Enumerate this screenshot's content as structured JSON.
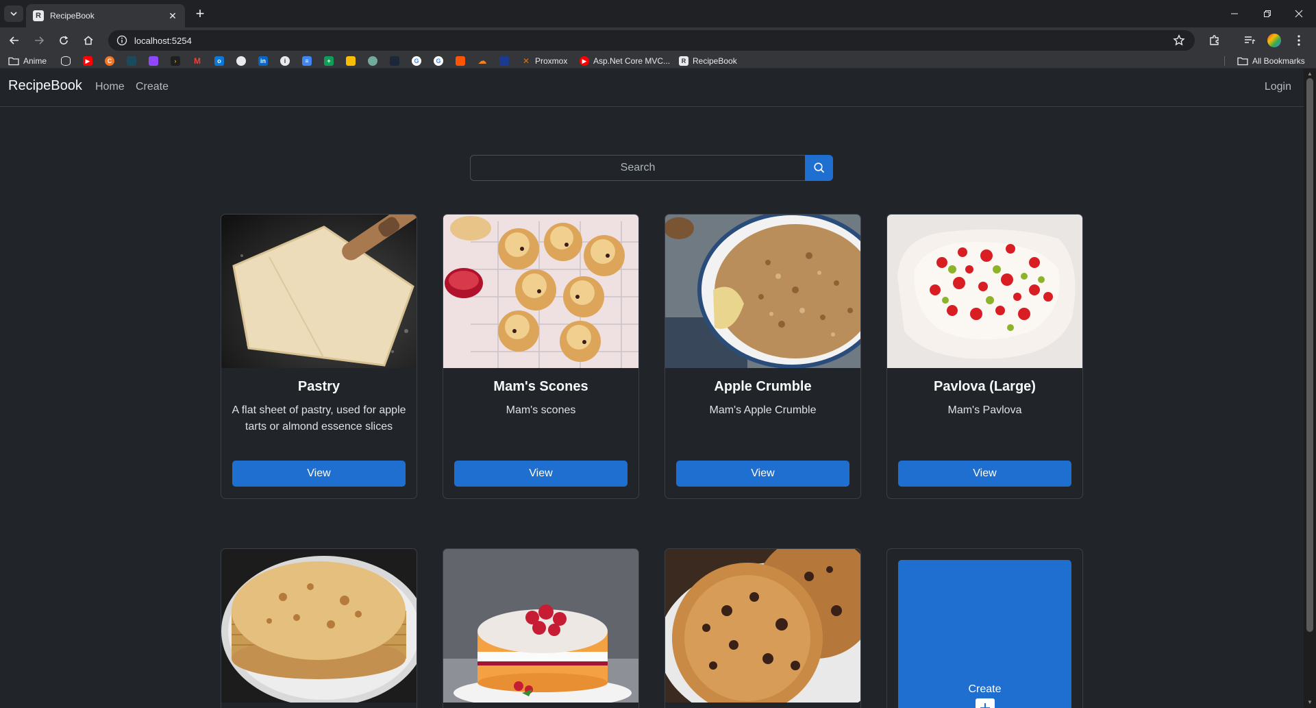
{
  "browser": {
    "tab_title": "RecipeBook",
    "url": "localhost:5254",
    "bookmarks": [
      {
        "label": "Anime",
        "icon": "folder-icon"
      },
      {
        "label": "",
        "icon": "database-icon"
      },
      {
        "label": "",
        "icon": "youtube-icon"
      },
      {
        "label": "",
        "icon": "crunchyroll-icon"
      },
      {
        "label": "",
        "icon": "rss-icon"
      },
      {
        "label": "",
        "icon": "twitch-icon"
      },
      {
        "label": "",
        "icon": "plex-icon"
      },
      {
        "label": "",
        "icon": "gmail-icon"
      },
      {
        "label": "",
        "icon": "outlook-icon"
      },
      {
        "label": "",
        "icon": "github-icon"
      },
      {
        "label": "",
        "icon": "linkedin-icon"
      },
      {
        "label": "",
        "icon": "info-icon"
      },
      {
        "label": "",
        "icon": "docs-icon"
      },
      {
        "label": "",
        "icon": "sheets-icon"
      },
      {
        "label": "",
        "icon": "keep-icon"
      },
      {
        "label": "",
        "icon": "chatgpt-icon"
      },
      {
        "label": "",
        "icon": "steam-icon"
      },
      {
        "label": "",
        "icon": "google-icon"
      },
      {
        "label": "",
        "icon": "google-alt-icon"
      },
      {
        "label": "",
        "icon": "soundcloud-icon"
      },
      {
        "label": "",
        "icon": "cloud-icon"
      },
      {
        "label": "",
        "icon": "app-icon"
      },
      {
        "label": "Proxmox",
        "icon": "proxmox-icon"
      },
      {
        "label": "Asp.Net Core MVC...",
        "icon": "youtube-icon"
      },
      {
        "label": "RecipeBook",
        "icon": "recipebook-icon"
      }
    ],
    "all_bookmarks": "All Bookmarks"
  },
  "app": {
    "brand": "RecipeBook",
    "nav": {
      "home": "Home",
      "create": "Create",
      "login": "Login"
    },
    "search": {
      "placeholder": "Search"
    },
    "view_label": "View",
    "recipes": [
      {
        "title": "Pastry",
        "description": "A flat sheet of pastry, used for apple tarts or almond essence slices",
        "image": "pastry-image"
      },
      {
        "title": "Mam's Scones",
        "description": "Mam's scones",
        "image": "scones-image"
      },
      {
        "title": "Apple Crumble",
        "description": "Mam's Apple Crumble",
        "image": "crumble-image"
      },
      {
        "title": "Pavlova (Large)",
        "description": "Mam's Pavlova",
        "image": "pavlova-image"
      },
      {
        "title": "",
        "description": "",
        "image": "pancakes-image"
      },
      {
        "title": "",
        "description": "",
        "image": "sponge-cake-image"
      },
      {
        "title": "",
        "description": "",
        "image": "cookies-image"
      }
    ],
    "create_tile": {
      "label": "Create"
    }
  },
  "colors": {
    "page_bg": "#212529",
    "accent": "#1f6fd1",
    "card_border": "#3b4046"
  }
}
